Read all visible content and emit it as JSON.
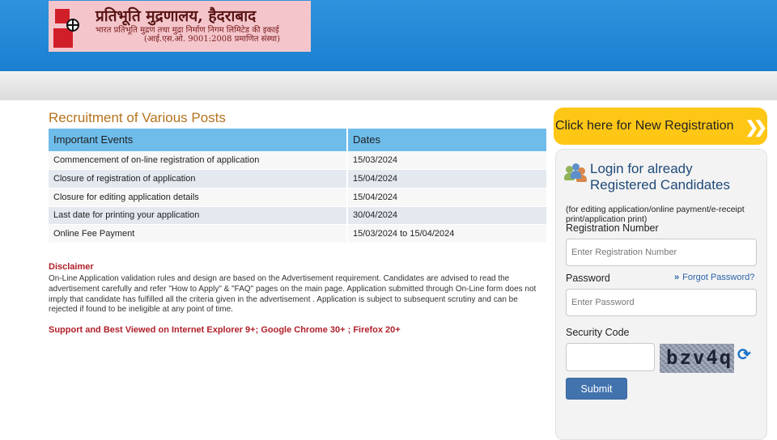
{
  "header": {
    "logo": {
      "line1": "प्रतिभूति मुद्रणालय, हैदराबाद",
      "line2": "भारत प्रतिभूति मुद्रण तथा मुद्रा निर्माण निगम लिमिटेड की इकाई",
      "line3": "(आई.एस.ओ. 9001:2008 प्रमाणित संस्था)"
    }
  },
  "main": {
    "title": "Recruitment of Various Posts",
    "table": {
      "headers": [
        "Important Events",
        "Dates"
      ],
      "rows": [
        [
          "Commencement of on-line registration of application",
          "15/03/2024"
        ],
        [
          "Closure of registration of application",
          "15/04/2024"
        ],
        [
          "Closure for editing application details",
          "15/04/2024"
        ],
        [
          "Last date for printing your application",
          "30/04/2024"
        ],
        [
          "Online Fee Payment",
          "15/03/2024 to 15/04/2024"
        ]
      ]
    },
    "disclaimer_title": "Disclaimer",
    "disclaimer_text": "On-Line Application validation rules and design are based on the Advertisement requirement. Candidates are advised to read the advertisement carefully and refer \"How to Apply\" & \"FAQ\" pages on the main page. Application submitted through On-Line form does not imply that candidate has fulfilled all the criteria given in the advertisement . Application is subject to subsequent scrutiny and can be rejected if found to be ineligible at any point of time.",
    "support_text": "Support and Best Viewed on Internet Explorer 9+; Google Chrome 30+ ; Firefox 20+"
  },
  "sidebar": {
    "new_registration": "Click here for New Registration",
    "login": {
      "title_line1": "Login for already",
      "title_line2": "Registered Candidates",
      "note": "(for editing application/online payment/e-receipt print/application print)",
      "reg_label": "Registration Number",
      "reg_placeholder": "Enter Registration Number",
      "password_label": "Password",
      "forgot": "Forgot Password?",
      "password_placeholder": "Enter Password",
      "security_label": "Security Code",
      "captcha": "bzv4q",
      "submit": "Submit"
    }
  },
  "colors": {
    "header_blue": "#1a7fd0",
    "title_orange": "#b5731e",
    "table_header": "#6ebcea",
    "disclaimer_red": "#b0202a",
    "registration_yellow": "#ffc715",
    "login_blue": "#1f4a78",
    "submit_blue": "#4273ad"
  },
  "icons": [
    "logo-mark",
    "users-icon",
    "double-chevron-icon",
    "refresh-icon"
  ]
}
